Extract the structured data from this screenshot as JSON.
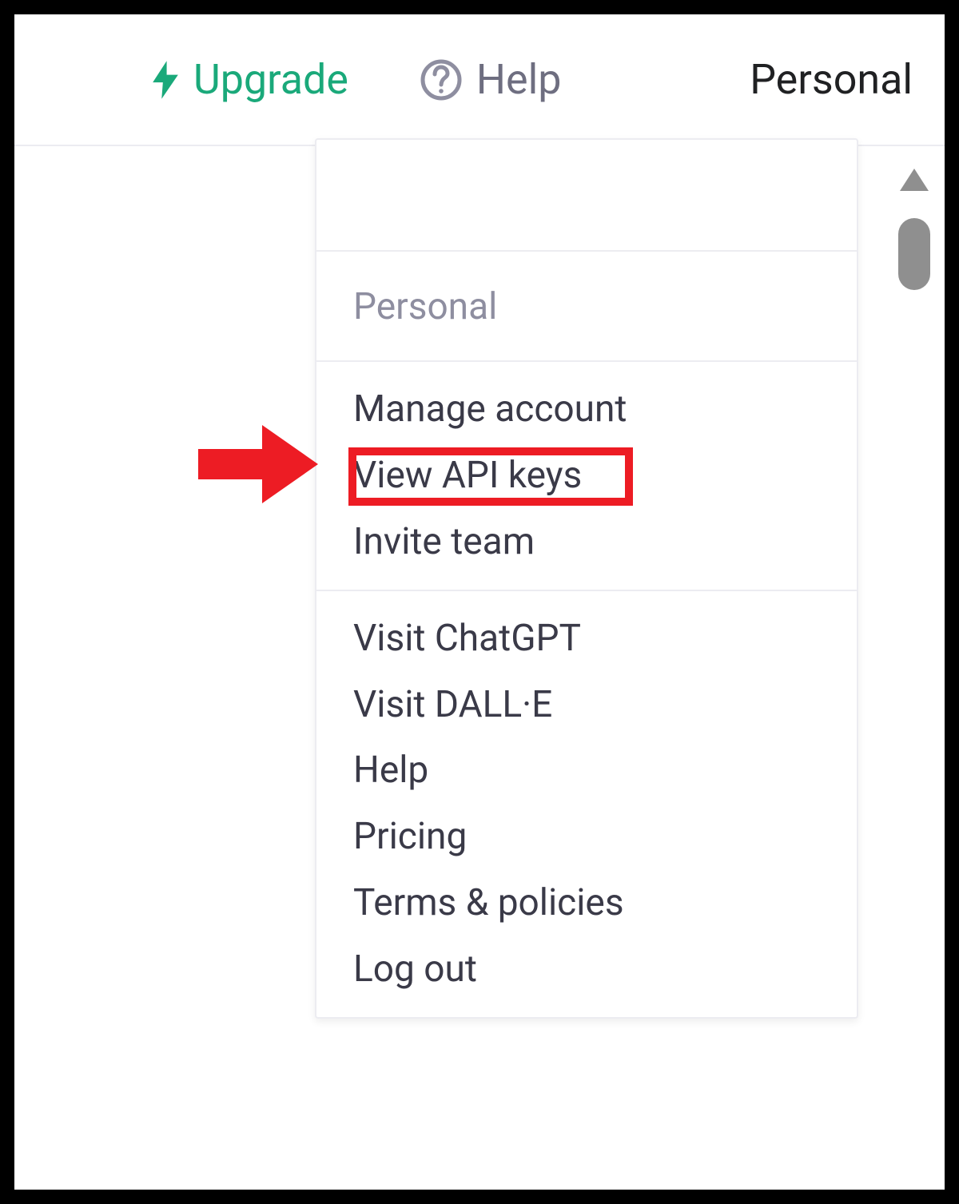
{
  "header": {
    "upgrade_label": "Upgrade",
    "help_label": "Help",
    "personal_label": "Personal"
  },
  "dropdown": {
    "section_label": "Personal",
    "group1": {
      "manage_account": "Manage account",
      "view_api_keys": "View API keys",
      "invite_team": "Invite team"
    },
    "group2": {
      "visit_chatgpt": "Visit ChatGPT",
      "visit_dalle": "Visit DALL·E",
      "help": "Help",
      "pricing": "Pricing",
      "terms": "Terms & policies",
      "logout": "Log out"
    }
  },
  "colors": {
    "accent_green": "#1aa97a",
    "annotation_red": "#ed1c24"
  }
}
